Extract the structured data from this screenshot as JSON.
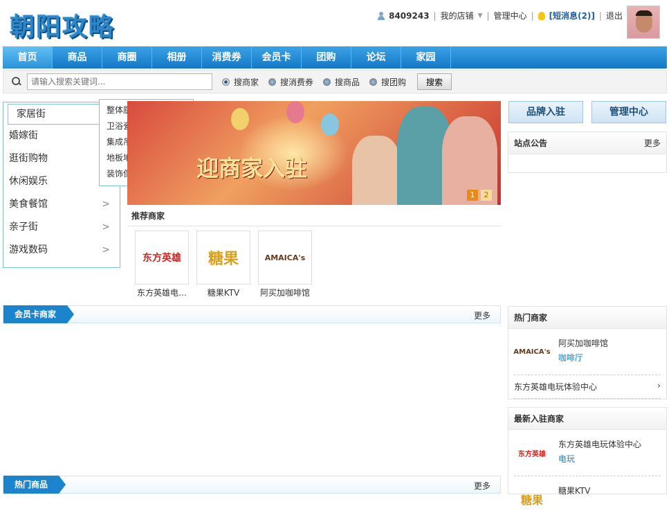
{
  "logo": "朝阳攻略",
  "topbar": {
    "user_id": "8409243",
    "my_shop": "我的店铺",
    "admin": "管理中心",
    "messages": "[短消息(2)]",
    "logout": "退出"
  },
  "nav": {
    "tabs": [
      "首页",
      "商品",
      "商圈",
      "相册",
      "消费券",
      "会员卡",
      "团购",
      "论坛",
      "家园"
    ]
  },
  "search": {
    "placeholder": "请输入搜索关键词...",
    "options": [
      "搜商家",
      "搜消费券",
      "搜商品",
      "搜团购"
    ],
    "selected": "搜商家",
    "button": "搜索"
  },
  "categories": {
    "items": [
      {
        "label": "家居街",
        "arrow": ""
      },
      {
        "label": "婚嫁街",
        "arrow": ""
      },
      {
        "label": "逛街购物",
        "arrow": ""
      },
      {
        "label": "休闲娱乐",
        "arrow": ""
      },
      {
        "label": "美食餐馆",
        "arrow": ">"
      },
      {
        "label": "亲子街",
        "arrow": ">"
      },
      {
        "label": "游戏数码",
        "arrow": ">"
      }
    ],
    "submenu": [
      "整体厨房",
      "卫浴瓷砖",
      "集成吊顶",
      "地板地暖",
      "装饰保洁"
    ]
  },
  "banner": {
    "text": "迎商家入驻",
    "pages": [
      "1",
      "2"
    ]
  },
  "recommended": {
    "title": "推荐商家",
    "items": [
      {
        "name": "东方英雄电…",
        "logo_text": "东方英雄",
        "color": "#d0251f"
      },
      {
        "name": "糖果KTV",
        "logo_text": "糖果",
        "color": "#d7a01e"
      },
      {
        "name": "阿买加咖啡馆",
        "logo_text": "AMAICA's",
        "color": "#6b3a1e"
      }
    ]
  },
  "sidebar": {
    "brand_button": "品牌入驻",
    "admin_button": "管理中心",
    "notice": {
      "title": "站点公告",
      "more": "更多"
    },
    "hot_shops": {
      "title": "热门商家",
      "top": {
        "name": "阿买加咖啡馆",
        "type": "咖啡厅",
        "logo_text": "AMAICA's"
      },
      "list": [
        {
          "name": "东方英雄电玩体验中心",
          "arrow": "›"
        }
      ]
    },
    "new_shops": {
      "title": "最新入驻商家",
      "items": [
        {
          "name": "东方英雄电玩体验中心",
          "type": "电玩",
          "logo_text": "东方英雄"
        },
        {
          "name": "糖果KTV",
          "type": "",
          "logo_text": "糖果"
        }
      ]
    }
  },
  "sections": {
    "member_card": {
      "label": "会员卡商家",
      "more": "更多"
    },
    "hot_products": {
      "label": "热门商品",
      "more": "更多"
    }
  },
  "colors": {
    "brand_blue": "#1b84cd",
    "link_blue": "#1b7cc0"
  }
}
